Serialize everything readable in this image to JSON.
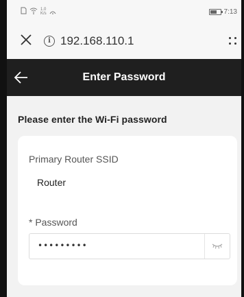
{
  "status_bar": {
    "left_icons": [
      "sim-icon",
      "wifi-icon",
      "data-speed-icon",
      "signal-icon"
    ],
    "speed_text": "1.0",
    "speed_unit": "K/s",
    "time": "7:13"
  },
  "browser": {
    "url": "192.168.110.1",
    "close_icon": "close-icon",
    "info_icon": "info-icon",
    "menu_icon": "menu-icon"
  },
  "header": {
    "title": "Enter Password",
    "back_icon": "arrow-left-icon",
    "background": "#1f1f1f"
  },
  "form": {
    "instruction": "Please enter the Wi-Fi password",
    "ssid_label": "Primary Router SSID",
    "ssid_value": "Router",
    "password_label": "* Password",
    "password_value": "•••••••••",
    "password_toggle_icon": "eye-closed-icon"
  }
}
